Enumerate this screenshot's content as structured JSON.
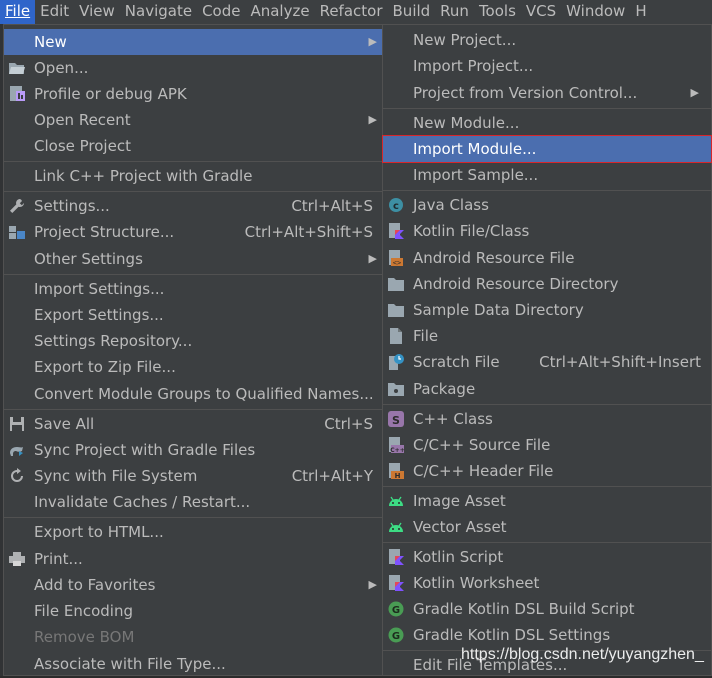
{
  "menubar": [
    "File",
    "Edit",
    "View",
    "Navigate",
    "Code",
    "Analyze",
    "Refactor",
    "Build",
    "Run",
    "Tools",
    "VCS",
    "Window",
    "H"
  ],
  "file_menu": {
    "new": "New",
    "open": "Open...",
    "profile_apk": "Profile or debug APK",
    "open_recent": "Open Recent",
    "close_project": "Close Project",
    "link_cpp": "Link C++ Project with Gradle",
    "settings": "Settings...",
    "settings_sc": "Ctrl+Alt+S",
    "project_structure": "Project Structure...",
    "project_structure_sc": "Ctrl+Alt+Shift+S",
    "other_settings": "Other Settings",
    "import_settings": "Import Settings...",
    "export_settings": "Export Settings...",
    "settings_repo": "Settings Repository...",
    "export_zip": "Export to Zip File...",
    "convert_module": "Convert Module Groups to Qualified Names...",
    "save_all": "Save All",
    "save_all_sc": "Ctrl+S",
    "sync_gradle": "Sync Project with Gradle Files",
    "sync_fs": "Sync with File System",
    "sync_fs_sc": "Ctrl+Alt+Y",
    "invalidate": "Invalidate Caches / Restart...",
    "export_html": "Export to HTML...",
    "print": "Print...",
    "add_fav": "Add to Favorites",
    "file_encoding": "File Encoding",
    "remove_bom": "Remove BOM",
    "associate": "Associate with File Type..."
  },
  "new_submenu": {
    "new_project": "New Project...",
    "import_project": "Import Project...",
    "project_vcs": "Project from Version Control...",
    "new_module": "New Module...",
    "import_module": "Import Module...",
    "import_sample": "Import Sample...",
    "java_class": "Java Class",
    "kotlin_class": "Kotlin File/Class",
    "android_res_file": "Android Resource File",
    "android_res_dir": "Android Resource Directory",
    "sample_data_dir": "Sample Data Directory",
    "file": "File",
    "scratch_file": "Scratch File",
    "scratch_sc": "Ctrl+Alt+Shift+Insert",
    "package": "Package",
    "cpp_class": "C++ Class",
    "cpp_source": "C/C++ Source File",
    "cpp_header": "C/C++ Header File",
    "image_asset": "Image Asset",
    "vector_asset": "Vector Asset",
    "kotlin_script": "Kotlin Script",
    "kotlin_worksheet": "Kotlin Worksheet",
    "gradle_kts_build": "Gradle Kotlin DSL Build Script",
    "gradle_kts_settings": "Gradle Kotlin DSL Settings",
    "edit_templates": "Edit File Templates..."
  },
  "watermark": "https://blog.csdn.net/yuyangzhen_",
  "colors": {
    "selection": "#4b6eaf",
    "menubar_active": "#2f65ca",
    "highlight_border": "#d7262b",
    "menu_bg": "#3c3f41"
  }
}
